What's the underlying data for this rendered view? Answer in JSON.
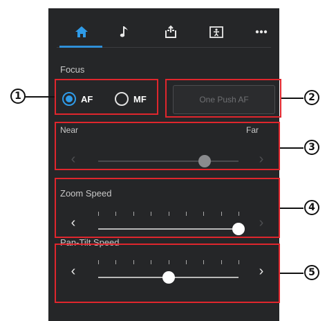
{
  "tabs": [
    {
      "icon": "home-icon"
    },
    {
      "icon": "music-note-icon"
    },
    {
      "icon": "tray-arrow-icon"
    },
    {
      "icon": "person-frame-icon"
    },
    {
      "icon": "more-icon"
    }
  ],
  "focus": {
    "label": "Focus",
    "af_label": "AF",
    "mf_label": "MF",
    "mode": "AF",
    "one_push_label": "One Push AF"
  },
  "focus_slider": {
    "near_label": "Near",
    "far_label": "Far",
    "value": 0.76,
    "left_arrow": "‹",
    "right_arrow": "›"
  },
  "zoom_speed": {
    "label": "Zoom Speed",
    "value": 1.0,
    "left_arrow": "‹",
    "right_arrow": "›"
  },
  "pan_tilt_speed": {
    "label": "Pan-Tilt Speed",
    "value": 0.5,
    "left_arrow": "‹",
    "right_arrow": "›"
  },
  "callouts": [
    "1",
    "2",
    "3",
    "4",
    "5"
  ],
  "colors": {
    "accent": "#2f9be8",
    "highlight": "#e0262d",
    "panel": "#252628"
  }
}
